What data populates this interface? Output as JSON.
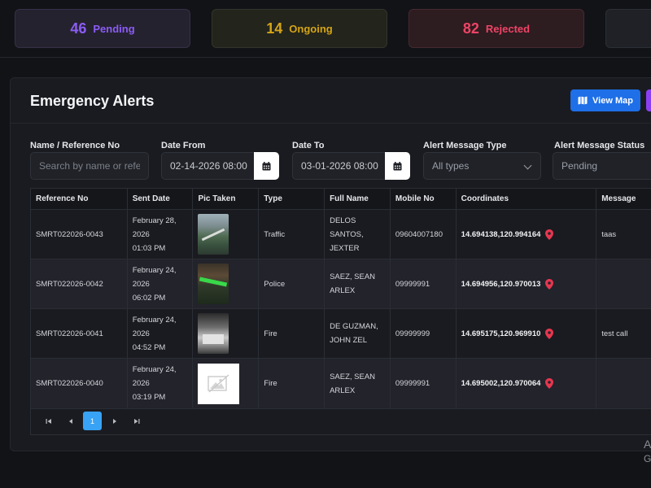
{
  "stats": {
    "pending": {
      "count": "46",
      "label": "Pending"
    },
    "ongoing": {
      "count": "14",
      "label": "Ongoing"
    },
    "rejected": {
      "count": "82",
      "label": "Rejected"
    }
  },
  "panel": {
    "title": "Emergency Alerts",
    "view_map_label": "View Map"
  },
  "filters": {
    "name_label": "Name / Reference No",
    "name_placeholder": "Search by name or reference",
    "date_from_label": "Date From",
    "date_from_value": "02-14-2026 08:00",
    "date_to_label": "Date To",
    "date_to_value": "03-01-2026 08:00",
    "type_label": "Alert Message Type",
    "type_value": "All types",
    "status_label": "Alert Message Status",
    "status_value": "Pending"
  },
  "table": {
    "headers": [
      "Reference No",
      "Sent Date",
      "Pic Taken",
      "Type",
      "Full Name",
      "Mobile No",
      "Coordinates",
      "Message"
    ],
    "rows": [
      {
        "ref": "SMRT022026-0043",
        "date": "February 28, 2026",
        "time": "01:03 PM",
        "type": "Traffic",
        "name1": "DELOS SANTOS,",
        "name2": "JEXTER",
        "mobile": "09604007180",
        "coords": "14.694138,120.994164",
        "message": "taas"
      },
      {
        "ref": "SMRT022026-0042",
        "date": "February 24, 2026",
        "time": "06:02 PM",
        "type": "Police",
        "name1": "SAEZ, SEAN",
        "name2": "ARLEX",
        "mobile": "09999991",
        "coords": "14.694956,120.970013",
        "message": ""
      },
      {
        "ref": "SMRT022026-0041",
        "date": "February 24, 2026",
        "time": "04:52 PM",
        "type": "Fire",
        "name1": "DE GUZMAN,",
        "name2": "JOHN ZEL",
        "mobile": "09999999",
        "coords": "14.695175,120.969910",
        "message": "test call"
      },
      {
        "ref": "SMRT022026-0040",
        "date": "February 24, 2026",
        "time": "03:19 PM",
        "type": "Fire",
        "name1": "SAEZ, SEAN",
        "name2": "ARLEX",
        "mobile": "09999991",
        "coords": "14.695002,120.970064",
        "message": ""
      }
    ]
  },
  "pager": {
    "current_page": "1"
  },
  "watermark": {
    "line1": "A",
    "line2": "G"
  },
  "colors": {
    "accent": "#1e6fe8",
    "pending": "#8b5cf6",
    "ongoing": "#d4a517",
    "rejected": "#ef4466",
    "pin": "#e8364f"
  },
  "icons": {
    "map": "map-icon",
    "calendar": "calendar-icon",
    "pin": "map-pin-icon"
  }
}
